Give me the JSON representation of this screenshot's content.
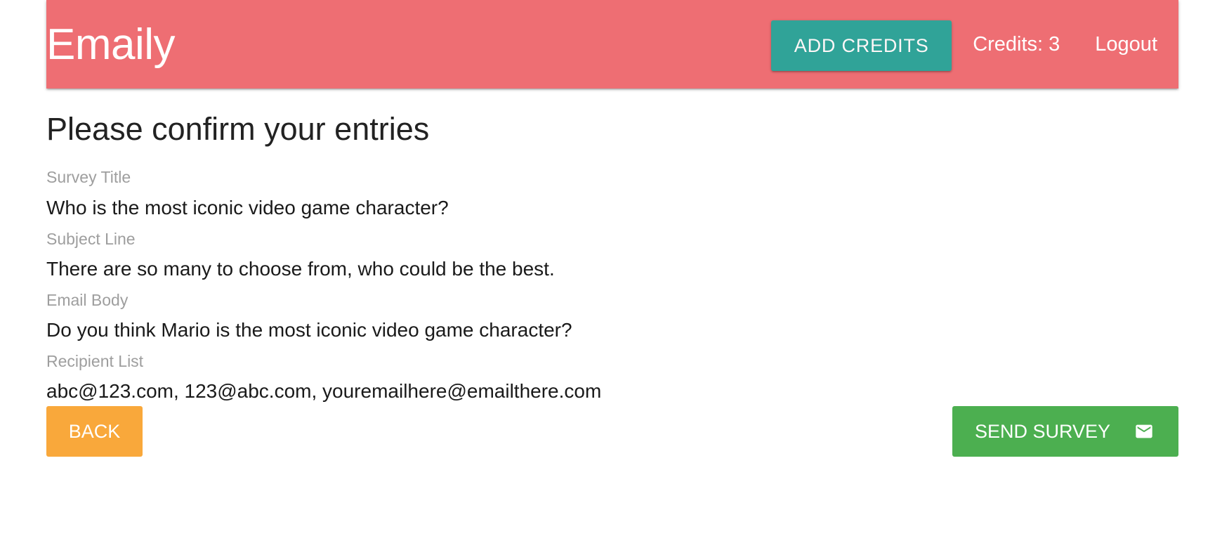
{
  "navbar": {
    "brand": "Emaily",
    "add_credits_label": "Add Credits",
    "credits_text": "Credits: 3",
    "logout_label": "Logout"
  },
  "page": {
    "title": "Please confirm your entries"
  },
  "fields": [
    {
      "label": "Survey Title",
      "value": "Who is the most iconic video game character?"
    },
    {
      "label": "Subject Line",
      "value": "There are so many to choose from, who could be the best."
    },
    {
      "label": "Email Body",
      "value": "Do you think Mario is the most iconic video game character?"
    },
    {
      "label": "Recipient List",
      "value": "abc@123.com, 123@abc.com, youremailhere@emailthere.com"
    }
  ],
  "actions": {
    "back_label": "Back",
    "send_label": "Send Survey",
    "send_icon": "mail-icon"
  },
  "colors": {
    "navbar": "#ee6e73",
    "add_credits": "#26a69a",
    "back": "#f9a83b",
    "send": "#4caf50"
  }
}
